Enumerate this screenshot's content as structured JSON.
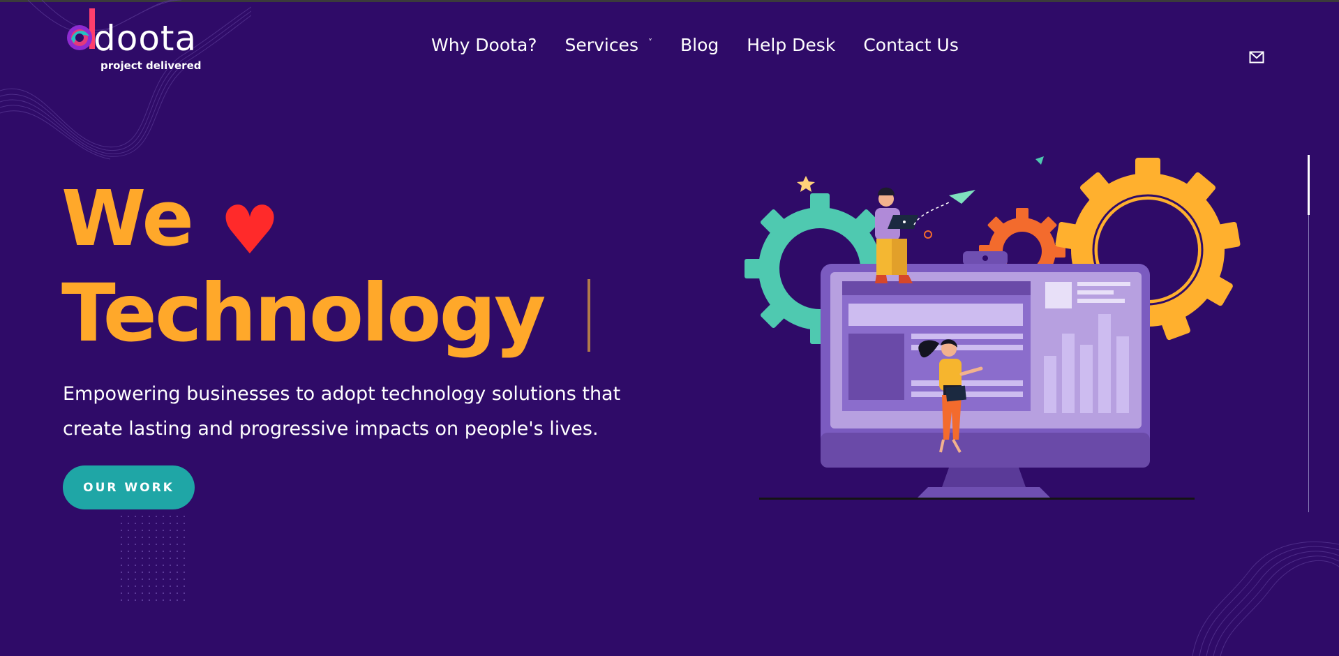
{
  "brand": {
    "name": "doota",
    "tagline": "project delivered"
  },
  "nav": {
    "items": [
      "Why Doota?",
      "Services",
      "Blog",
      "Help Desk",
      "Contact Us"
    ],
    "services_chevron": "˅"
  },
  "hero": {
    "line1": "We",
    "heart": "♥",
    "line2": "Technology",
    "subtitle": "Empowering businesses to adopt technology solutions that create lasting and progressive impacts on people's lives.",
    "cta": "OUR WORK"
  },
  "icons": [
    "mail-icon",
    "heart-icon",
    "chevron-down-icon"
  ],
  "colors": {
    "background": "#2f0b68",
    "accent": "#ffa82a",
    "heart": "#ff2a2a",
    "cta": "#1fa6a6"
  }
}
